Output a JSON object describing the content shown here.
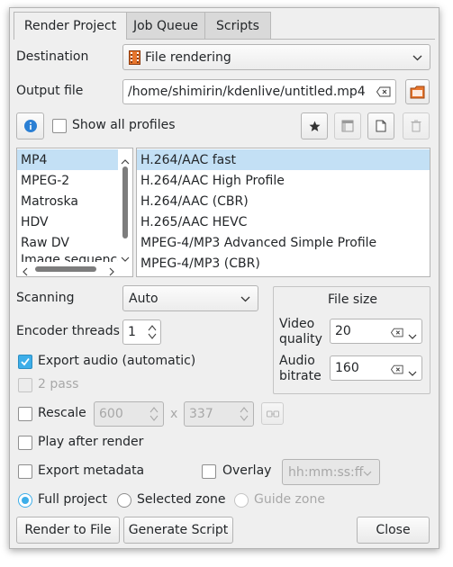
{
  "tabs": [
    {
      "label": "Render Project",
      "active": true
    },
    {
      "label": "Job Queue",
      "active": false
    },
    {
      "label": "Scripts",
      "active": false
    }
  ],
  "destination": {
    "label": "Destination",
    "value": "File rendering",
    "icon": "film-strip-icon"
  },
  "output_file": {
    "label": "Output file",
    "value": "/home/shimirin/kdenlive/untitled.mp4"
  },
  "show_all_profiles": {
    "label": "Show all profiles",
    "checked": false
  },
  "formats": [
    "MP4",
    "MPEG-2",
    "Matroska",
    "HDV",
    "Raw DV",
    "Image sequence"
  ],
  "profiles": [
    "H.264/AAC fast",
    "H.264/AAC High Profile",
    "H.264/AAC (CBR)",
    "H.265/AAC HEVC",
    "MPEG-4/MP3 Advanced Simple Profile",
    "MPEG-4/MP3 (CBR)"
  ],
  "scanning": {
    "label": "Scanning",
    "value": "Auto"
  },
  "encoder_threads": {
    "label": "Encoder threads",
    "value": "1"
  },
  "file_size": {
    "title": "File size",
    "video_quality_label_1": "Video",
    "video_quality_label_2": "quality",
    "video_quality_value": "20",
    "audio_bitrate_label_1": "Audio",
    "audio_bitrate_label_2": "bitrate",
    "audio_bitrate_value": "160"
  },
  "export_audio": {
    "label": "Export audio (automatic)",
    "checked": true
  },
  "two_pass": {
    "label": "2 pass",
    "checked": false,
    "enabled": false
  },
  "rescale": {
    "label": "Rescale",
    "width": "600",
    "x": "x",
    "height": "337"
  },
  "play_after_render": {
    "label": "Play after render"
  },
  "export_metadata": {
    "label": "Export metadata"
  },
  "overlay": {
    "label": "Overlay",
    "value": "hh:mm:ss:ff"
  },
  "zones": {
    "full": "Full project",
    "selected": "Selected zone",
    "guide": "Guide zone"
  },
  "buttons": {
    "render": "Render to File",
    "generate": "Generate Script",
    "close": "Close"
  },
  "colors": {
    "accent": "#3daee9",
    "selection": "#c3e0f5",
    "info_button": "#2a7fd4"
  }
}
